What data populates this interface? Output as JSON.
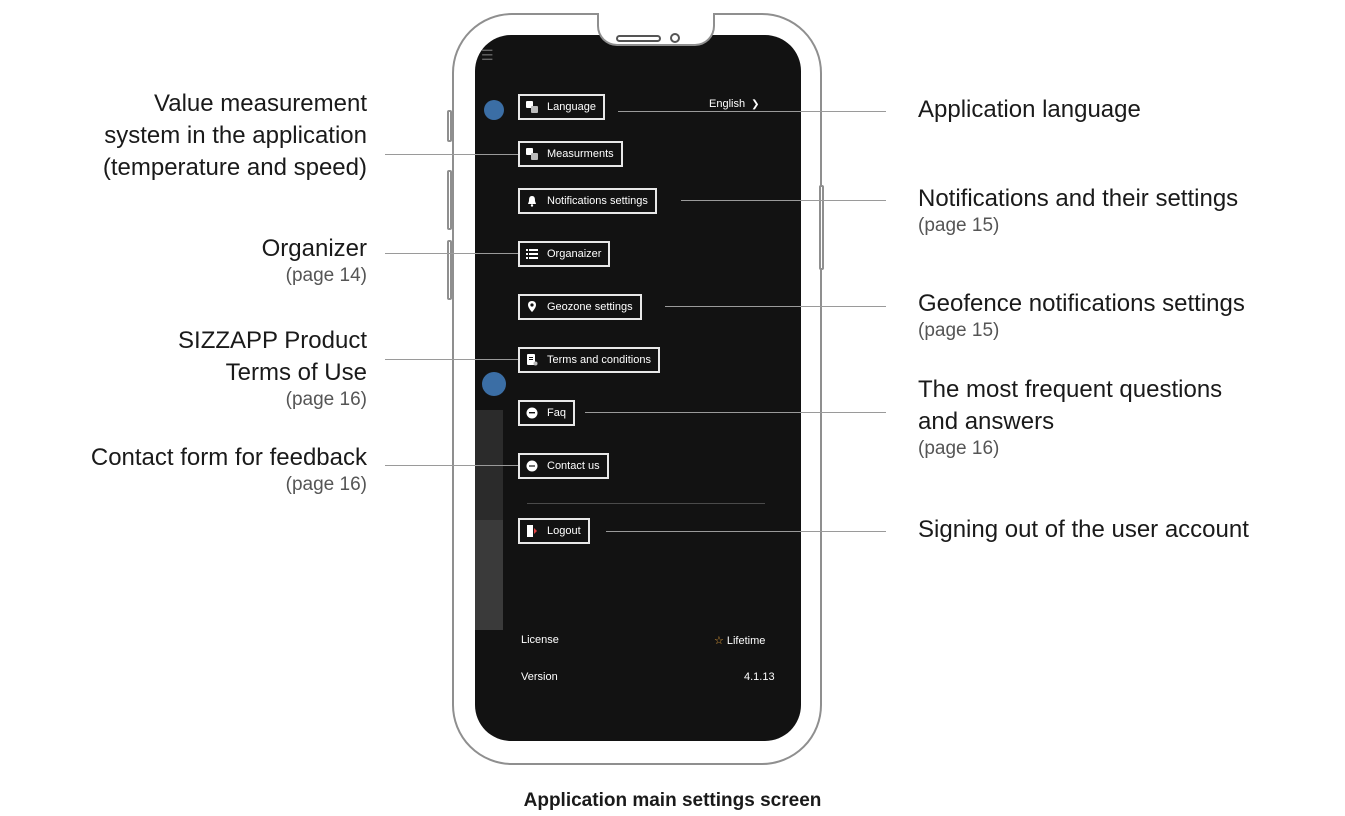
{
  "caption": "Application main settings screen",
  "menu": {
    "language": "Language",
    "language_value": "English",
    "measurements": "Measurments",
    "notifications": "Notifications settings",
    "organizer": "Organaizer",
    "geozone": "Geozone settings",
    "terms": "Terms and conditions",
    "faq": "Faq",
    "contact": "Contact us",
    "logout": "Logout"
  },
  "info": {
    "license_label": "License",
    "license_value": "Lifetime",
    "version_label": "Version",
    "version_value": "4.1.13"
  },
  "callouts_left": {
    "measurement_l1": "Value measurement",
    "measurement_l2": "system in the application",
    "measurement_l3": "(temperature and speed)",
    "organizer": "Organizer",
    "organizer_page": "(page 14)",
    "terms_l1": "SIZZAPP Product",
    "terms_l2": "Terms of Use",
    "terms_page": "(page 16)",
    "contact": "Contact form for feedback",
    "contact_page": "(page 16)"
  },
  "callouts_right": {
    "language": "Application language",
    "notifications": "Notifications and their settings",
    "notifications_page": "(page 15)",
    "geofence": "Geofence notifications settings",
    "geofence_page": "(page 15)",
    "faq_l1": "The most frequent questions",
    "faq_l2": "and answers",
    "faq_page": "(page 16)",
    "logout": "Signing out of the user account"
  },
  "colors": {
    "screen_bg": "#121212",
    "accent_star": "#e8a33d",
    "logout_icon": "#e04040",
    "peek_blue": "#3b6ea5"
  }
}
